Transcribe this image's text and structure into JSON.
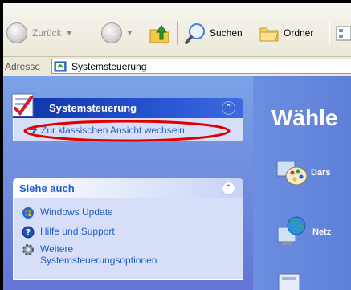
{
  "toolbar": {
    "back_label": "Zurück",
    "search_label": "Suchen",
    "folders_label": "Ordner"
  },
  "address_bar": {
    "label": "Adresse",
    "value": "Systemsteuerung"
  },
  "left_pane": {
    "control_panel": {
      "title": "Systemsteuerung",
      "switch_link": "Zur klassischen Ansicht wechseln"
    },
    "see_also": {
      "title": "Siehe auch",
      "items": [
        {
          "label": "Windows Update",
          "icon": "windows-update-icon"
        },
        {
          "label": "Hilfe und Support",
          "icon": "help-icon"
        },
        {
          "label": "Weitere Systemsteuerungsoptionen",
          "icon": "gear-icon"
        }
      ]
    }
  },
  "right_pane": {
    "heading": "Wähle",
    "categories": [
      {
        "label": "Dars",
        "icon": "appearance-icon"
      },
      {
        "label": "Netz",
        "icon": "network-icon"
      }
    ]
  },
  "colors": {
    "task_pane_top": "#7ba2e7",
    "task_pane_bottom": "#6375d6",
    "header_blue": "#0c32a4",
    "link_blue": "#215dc6",
    "annotation_ellipse": "#e00000"
  }
}
